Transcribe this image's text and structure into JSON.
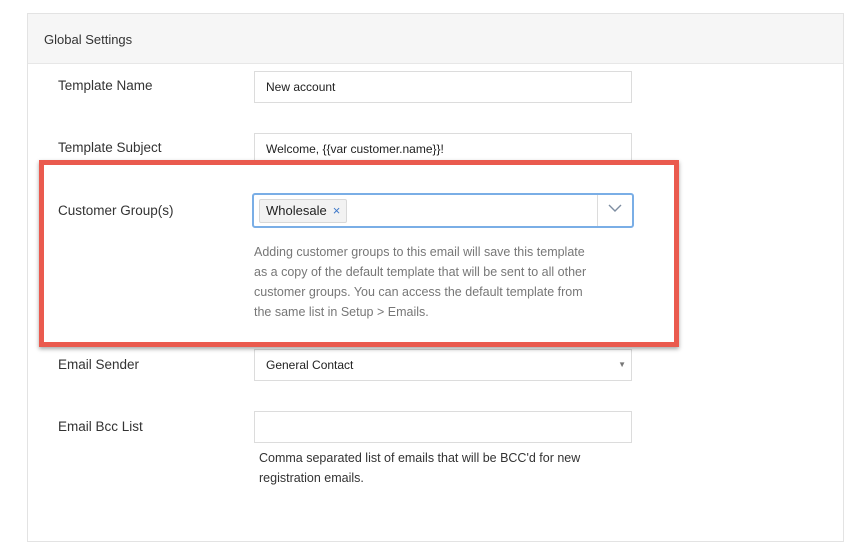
{
  "panel": {
    "title": "Global Settings"
  },
  "fields": {
    "template_name": {
      "label": "Template Name",
      "value": "New account"
    },
    "template_subject": {
      "label": "Template Subject",
      "value": "Welcome, {{var customer.name}}!"
    },
    "customer_groups": {
      "label": "Customer Group(s)",
      "selected": [
        "Wholesale"
      ],
      "remove_glyph": "×",
      "help_lines": [
        "Adding customer groups to this email will save this template",
        "as a copy of the default template that will be sent to all other",
        "customer groups. You can access the default template from",
        "the same list in Setup > Emails."
      ]
    },
    "email_sender": {
      "label": "Email Sender",
      "value": "General Contact"
    },
    "email_bcc": {
      "label": "Email Bcc List",
      "value": "",
      "help_lines": [
        "Comma separated list of emails that will be BCC'd for new",
        "registration emails."
      ]
    }
  },
  "icons": {
    "dropdown_arrow": "chevron-down-icon",
    "select_arrow": "caret-down-icon",
    "tag_remove": "close-icon"
  },
  "colors": {
    "highlight_border": "#ea5a4e",
    "focus_border": "#7aaee6",
    "tag_remove": "#3d78c9"
  }
}
